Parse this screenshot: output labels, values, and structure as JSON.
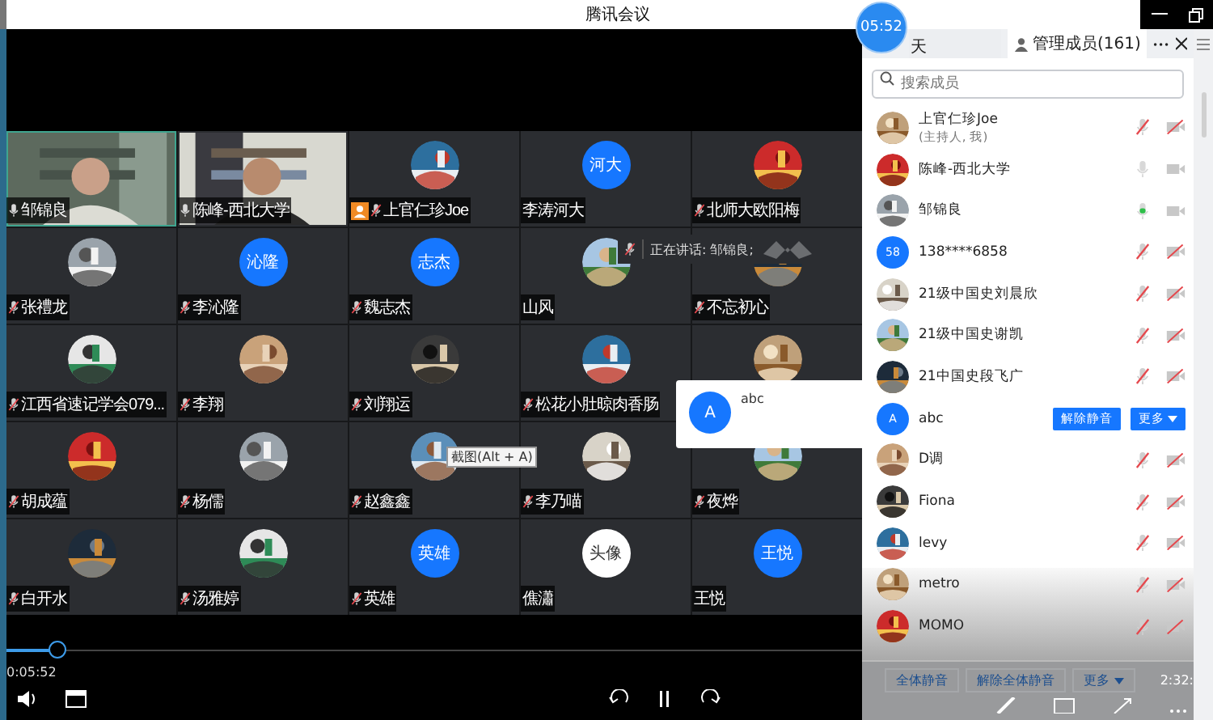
{
  "window": {
    "title": "腾讯会议"
  },
  "timer": "05:52",
  "tiles": [
    {
      "kind": "video",
      "name": "邹锦良",
      "muted": false,
      "active": true,
      "host": false
    },
    {
      "kind": "video",
      "name": "陈峰-西北大学",
      "muted": false,
      "active": false,
      "host": false
    },
    {
      "kind": "picture",
      "name": "上官仁珍Joe",
      "muted": true,
      "active": false,
      "host": true
    },
    {
      "kind": "initials",
      "initials": "河大",
      "color": "#1677ff",
      "name": "李涛河大",
      "active": false,
      "host": false
    },
    {
      "kind": "picture",
      "name": "北师大欧阳梅",
      "muted": true,
      "active": false,
      "host": false
    },
    {
      "kind": "picture",
      "name": "张禮龙",
      "muted": true,
      "active": false,
      "host": false
    },
    {
      "kind": "initials",
      "initials": "沁隆",
      "color": "#1677ff",
      "name": "李沁隆",
      "muted": true,
      "active": false,
      "host": false
    },
    {
      "kind": "initials",
      "initials": "志杰",
      "color": "#1677ff",
      "name": "魏志杰",
      "muted": true,
      "active": false,
      "host": false
    },
    {
      "kind": "picture",
      "name": "山风",
      "active": false,
      "host": false
    },
    {
      "kind": "picture",
      "name": "不忘初心",
      "muted": true,
      "active": false,
      "host": false
    },
    {
      "kind": "picture",
      "name": "江西省速记学会079...",
      "muted": true,
      "active": false,
      "host": false
    },
    {
      "kind": "picture",
      "name": "李翔",
      "muted": true,
      "active": false,
      "host": false
    },
    {
      "kind": "picture",
      "name": "刘翔运",
      "muted": true,
      "active": false,
      "host": false
    },
    {
      "kind": "picture",
      "name": "松花小肚晾肉香肠",
      "muted": true,
      "active": false,
      "host": false
    },
    {
      "kind": "picture",
      "active": false
    },
    {
      "kind": "picture",
      "name": "胡成蕴",
      "muted": true,
      "active": false,
      "host": false
    },
    {
      "kind": "picture",
      "name": "杨儒",
      "muted": true,
      "active": false,
      "host": false
    },
    {
      "kind": "picture",
      "name": "赵鑫鑫",
      "muted": true,
      "active": false,
      "host": false
    },
    {
      "kind": "picture",
      "name": "李乃喵",
      "muted": true,
      "active": false,
      "host": false
    },
    {
      "kind": "picture",
      "name": "夜烨",
      "muted": true,
      "active": false,
      "host": false
    },
    {
      "kind": "picture",
      "name": "白开水",
      "muted": true,
      "active": false,
      "host": false
    },
    {
      "kind": "picture",
      "name": "汤雅婷",
      "muted": true,
      "active": false,
      "host": false
    },
    {
      "kind": "initials",
      "initials": "英雄",
      "color": "#1677ff",
      "name": "英雄",
      "muted": true,
      "active": false,
      "host": false
    },
    {
      "kind": "initials",
      "initials": "头像",
      "color": "#ffffff",
      "name": "僬瀟",
      "active": false,
      "host": false
    },
    {
      "kind": "initials",
      "initials": "王悦",
      "color": "#1677ff",
      "name": "王悦",
      "active": false,
      "host": false
    }
  ],
  "speaking": {
    "text": "正在讲话: 邹锦良;"
  },
  "popup": {
    "initial": "A",
    "name": "abc"
  },
  "tooltip": "截图(Alt + A)",
  "player": {
    "time": "0:05:52",
    "level": 0.06
  },
  "panel": {
    "tabs": [
      {
        "label": "天",
        "selected": false
      },
      {
        "label": "管理成员(161)",
        "selected": true
      }
    ],
    "search": {
      "placeholder": "搜索成员"
    },
    "members": [
      {
        "kind": "picture",
        "name": "上官仁珍Joe",
        "note": "(主持人, 我)",
        "muted": true,
        "camera_on": false
      },
      {
        "kind": "picture",
        "name": "陈峰-西北大学",
        "muted": false,
        "speaking": false,
        "camera_on": true
      },
      {
        "kind": "picture",
        "name": "邹锦良",
        "muted": false,
        "speaking": true,
        "camera_on": true
      },
      {
        "kind": "initials",
        "initials": "58",
        "name": "138****6858",
        "muted": true,
        "camera_on": false
      },
      {
        "kind": "picture",
        "name": "21级中国史刘晨欣",
        "muted": true,
        "camera_on": false
      },
      {
        "kind": "picture",
        "name": "21级中国史谢凯",
        "muted": true,
        "camera_on": false
      },
      {
        "kind": "picture",
        "name": "21中国史段飞广",
        "muted": true,
        "camera_on": false
      },
      {
        "kind": "initials",
        "initials": "A",
        "name": "abc",
        "actions": [
          "解除静音",
          "更多"
        ]
      },
      {
        "kind": "picture",
        "name": "D调",
        "muted": true,
        "camera_on": false
      },
      {
        "kind": "picture",
        "name": "Fiona",
        "muted": true,
        "camera_on": false
      },
      {
        "kind": "picture",
        "name": "levy",
        "muted": true,
        "camera_on": false
      },
      {
        "kind": "picture",
        "name": "metro",
        "muted": true,
        "camera_on": false
      },
      {
        "kind": "picture",
        "name": "MOMO",
        "muted": true,
        "camera_on": false
      }
    ],
    "buttons": [
      "全体静音",
      "解除全体静音",
      "更多"
    ],
    "time": "2:32:"
  }
}
